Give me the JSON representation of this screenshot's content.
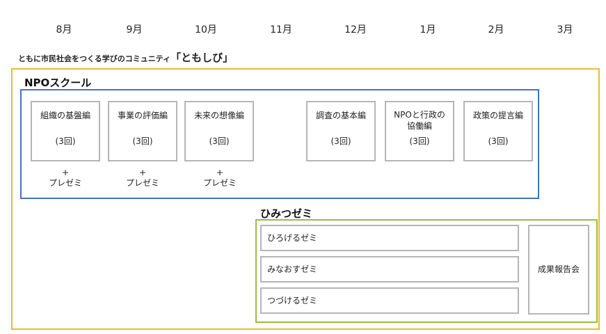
{
  "months": [
    "8月",
    "9月",
    "10月",
    "11月",
    "12月",
    "1月",
    "2月",
    "3月"
  ],
  "subtitle": {
    "small": "ともに市民社会をつくる学びのコミュニティ",
    "big": "「ともしび」"
  },
  "npo_school": {
    "title": "NPOスクール",
    "courses": [
      {
        "name": "組織の基盤編",
        "count": "(3回)"
      },
      {
        "name": "事業の評価編",
        "count": "(3回)"
      },
      {
        "name": "未来の想像編",
        "count": "(3回)"
      },
      {
        "name": "調査の基本編",
        "count": "(3回)"
      },
      {
        "name_line1": "NPOと行政の",
        "name_line2": "協働編",
        "count": "(3回)"
      },
      {
        "name": "政策の提言編",
        "count": "(3回)"
      }
    ],
    "plus_sign": "+",
    "plus_label": "プレゼミ"
  },
  "himitsu_zemi": {
    "title": "ひみつゼミ",
    "items": [
      "ひろげるゼミ",
      "みなおすゼミ",
      "つづけるゼミ"
    ],
    "report": "成果報告会"
  }
}
